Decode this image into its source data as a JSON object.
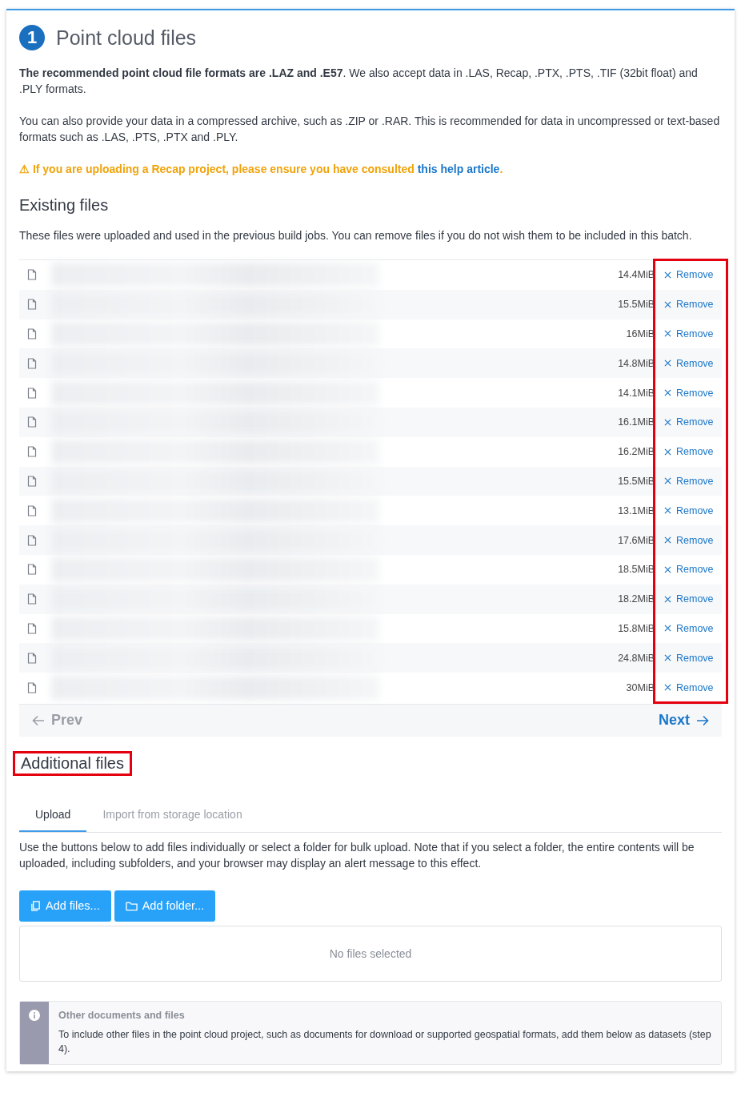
{
  "step": {
    "number": "1",
    "title": "Point cloud files"
  },
  "intro": [
    "**The recommended point cloud file formats are .LAZ and .E57**. We also accept data in .LAS, Recap, .PTX, .PTS, .TIF (32bit float) and .PLY formats.",
    "You can also provide your data in a compressed archive, such as .ZIP or .RAR. This is recommended for data in uncompressed or text-based formats such as .LAS, .PTS, .PTX and .PLY."
  ],
  "warning": {
    "icon": "⚠",
    "text": "If you are uploading a Recap project, please ensure you have consulted",
    "link": "this help article",
    "end": "."
  },
  "existing": {
    "heading": "Existing files",
    "description": "These files were uploaded and used in the previous build jobs. You can remove files if you do not wish them to be included in this batch.",
    "remove_column_highlighted": true,
    "files": [
      {
        "size": "14.4MiB",
        "action": "Remove"
      },
      {
        "size": "15.5MiB",
        "action": "Remove"
      },
      {
        "size": "16MiB",
        "action": "Remove"
      },
      {
        "size": "14.8MiB",
        "action": "Remove"
      },
      {
        "size": "14.1MiB",
        "action": "Remove"
      },
      {
        "size": "16.1MiB",
        "action": "Remove"
      },
      {
        "size": "16.2MiB",
        "action": "Remove"
      },
      {
        "size": "15.5MiB",
        "action": "Remove"
      },
      {
        "size": "13.1MiB",
        "action": "Remove"
      },
      {
        "size": "17.6MiB",
        "action": "Remove"
      },
      {
        "size": "18.5MiB",
        "action": "Remove"
      },
      {
        "size": "18.2MiB",
        "action": "Remove"
      },
      {
        "size": "15.8MiB",
        "action": "Remove"
      },
      {
        "size": "24.8MiB",
        "action": "Remove"
      },
      {
        "size": "30MiB",
        "action": "Remove"
      }
    ],
    "pager": {
      "prev": {
        "label": "Prev",
        "disabled": true
      },
      "next": {
        "label": "Next",
        "disabled": false
      }
    }
  },
  "additional": {
    "heading": "Additional files",
    "heading_highlighted": true,
    "tabs": [
      {
        "label": "Upload",
        "selected": true
      },
      {
        "label": "Import from storage location",
        "selected": false
      }
    ],
    "description": "Use the buttons below to add files individually or select a folder for bulk upload. Note that if you select a folder, the entire contents will be uploaded, including subfolders, and your browser may display an alert message to this effect.",
    "buttons": [
      {
        "kind": "files",
        "label": "Add files..."
      },
      {
        "kind": "folder",
        "label": "Add folder..."
      }
    ],
    "dropzone": "No files selected"
  },
  "notice": {
    "title": "Other documents and files",
    "text": "To include other files in the point cloud project, such as documents for download or supported geospatial formats, add them below as datasets (step 4)."
  }
}
